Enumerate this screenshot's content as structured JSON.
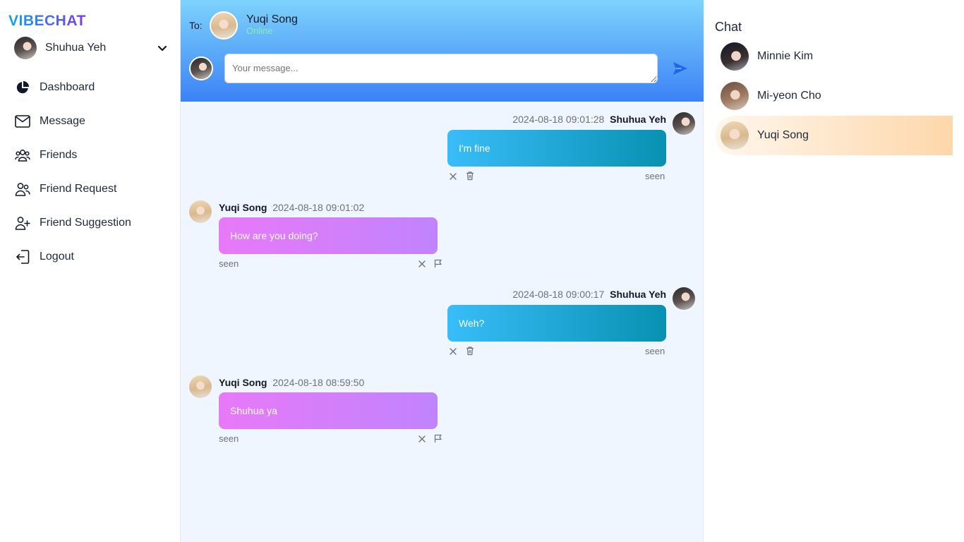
{
  "app": {
    "logo": "VIBECHAT"
  },
  "user": {
    "name": "Shuhua Yeh",
    "avatar_icon": "user-avatar"
  },
  "nav": {
    "items": [
      {
        "label": "Dashboard",
        "icon": "pie-chart-icon"
      },
      {
        "label": "Message",
        "icon": "envelope-icon"
      },
      {
        "label": "Friends",
        "icon": "users-icon"
      },
      {
        "label": "Friend Request",
        "icon": "user-request-icon"
      },
      {
        "label": "Friend Suggestion",
        "icon": "user-plus-icon"
      },
      {
        "label": "Logout",
        "icon": "logout-icon"
      }
    ]
  },
  "chat": {
    "to_label": "To:",
    "recipient": {
      "name": "Yuqi Song",
      "status": "Online"
    },
    "input": {
      "value": "",
      "placeholder": "Your message..."
    },
    "messages": [
      {
        "from": "me",
        "name": "Shuhua Yeh",
        "time": "2024-08-18 09:01:28",
        "text": "I'm fine",
        "status": "seen"
      },
      {
        "from": "them",
        "name": "Yuqi Song",
        "time": "2024-08-18 09:01:02",
        "text": "How are you doing?",
        "status": "seen"
      },
      {
        "from": "me",
        "name": "Shuhua Yeh",
        "time": "2024-08-18 09:00:17",
        "text": "Weh?",
        "status": "seen"
      },
      {
        "from": "them",
        "name": "Yuqi Song",
        "time": "2024-08-18 08:59:50",
        "text": "Shuhua ya",
        "status": "seen"
      }
    ]
  },
  "chat_list": {
    "title": "Chat",
    "contacts": [
      {
        "name": "Minnie Kim",
        "active": false
      },
      {
        "name": "Mi-yeon Cho",
        "active": false
      },
      {
        "name": "Yuqi Song",
        "active": true
      }
    ]
  },
  "colors": {
    "header_top": "#7dd3fc",
    "header_bottom": "#3b82f6",
    "my_bubble": "#0891b2",
    "their_bubble": "#d57cf8",
    "online": "#86efac",
    "active_contact": "#fed7aa"
  }
}
